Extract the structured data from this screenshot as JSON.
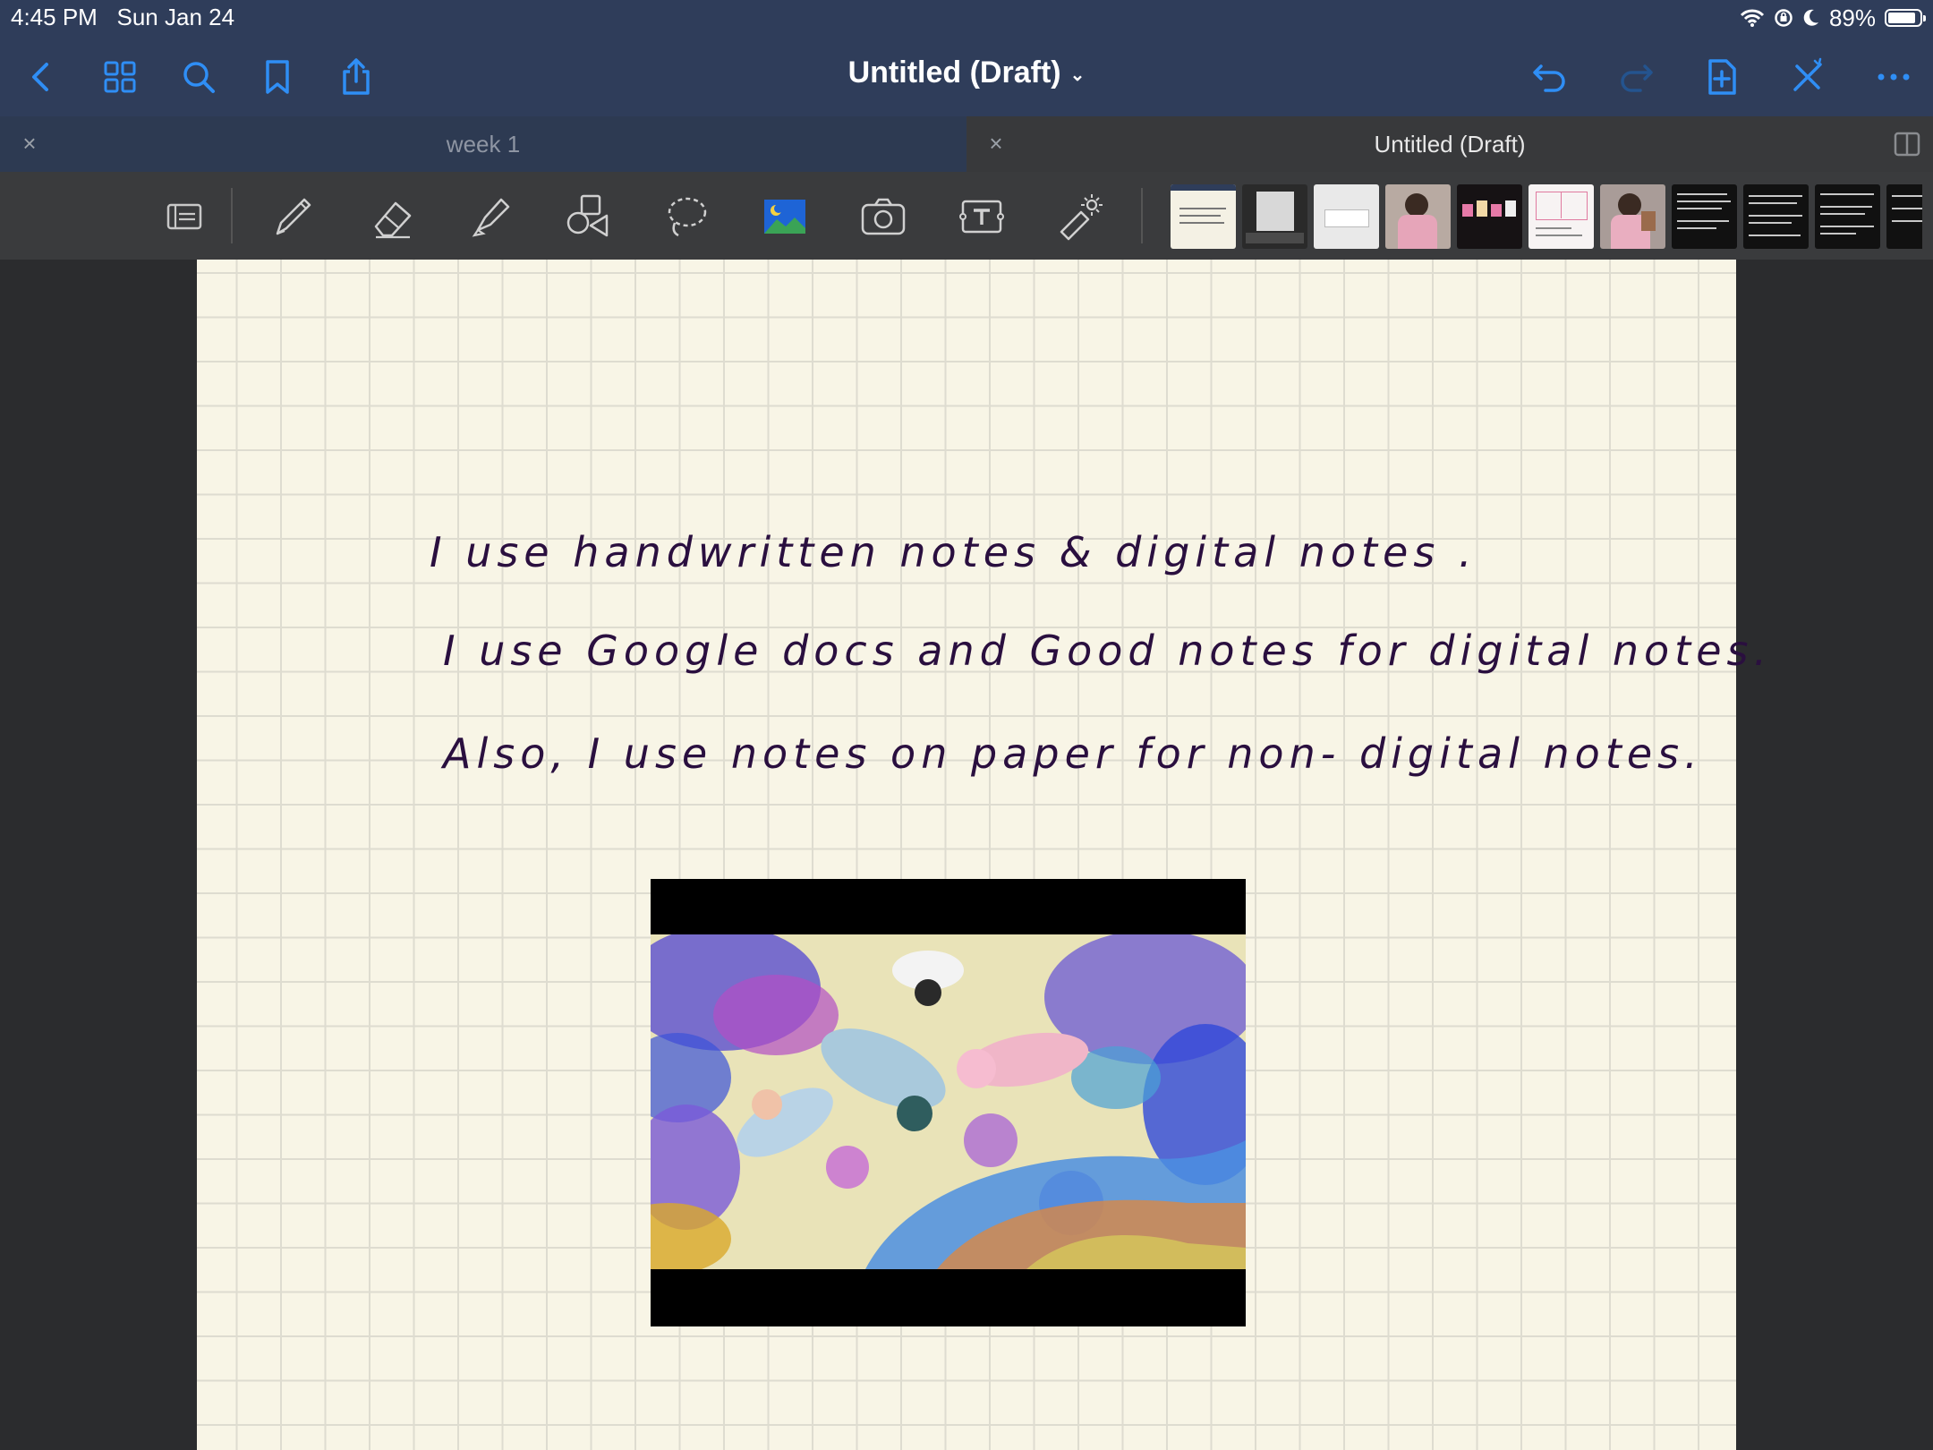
{
  "status": {
    "time": "4:45 PM",
    "date": "Sun Jan 24",
    "battery": "89%",
    "battery_level": 0.89
  },
  "nav": {
    "title": "Untitled (Draft)",
    "left_icons": [
      "back-chevron-icon",
      "grid-icon",
      "search-icon",
      "bookmark-icon",
      "share-icon"
    ],
    "right_icons": [
      "undo-icon",
      "redo-icon",
      "add-page-icon",
      "close-x-icon",
      "more-icon"
    ]
  },
  "tabs": [
    {
      "label": "week 1",
      "active": false
    },
    {
      "label": "Untitled (Draft)",
      "active": true
    }
  ],
  "toolbar": {
    "tools": [
      "read-only-icon",
      "pen-icon",
      "eraser-icon",
      "highlighter-icon",
      "shapes-icon",
      "lasso-icon",
      "image-icon",
      "camera-icon",
      "text-icon",
      "laser-pointer-icon"
    ]
  },
  "colors": {
    "nav_bar": "#2f3d5a",
    "accent_blue": "#2f8ef5",
    "paper": "#f8f5e6",
    "ink": "#2a0f3f"
  },
  "note": {
    "lines": [
      "I use handwritten notes & digital notes .",
      "I use Google docs and Good notes for digital notes.",
      "Also, I use notes on paper for non- digital notes."
    ]
  }
}
